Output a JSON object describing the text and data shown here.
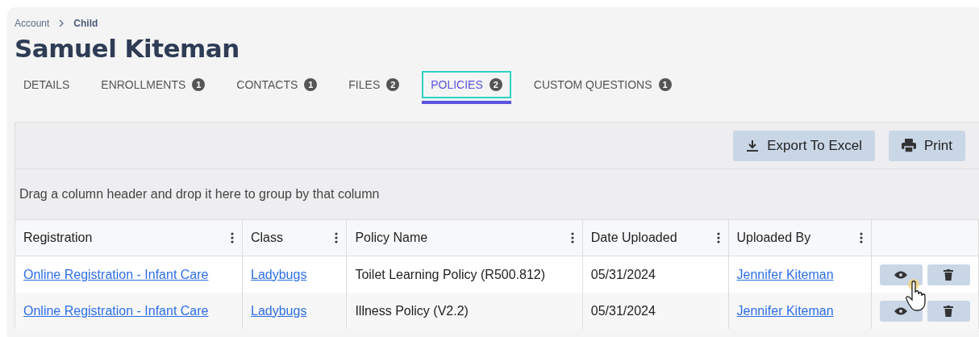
{
  "breadcrumb": [
    "Account",
    "Child"
  ],
  "title": "Samuel Kiteman",
  "tabs": [
    {
      "label": "DETAILS",
      "selected": false
    },
    {
      "label": "ENROLLMENTS",
      "count": "1",
      "selected": false
    },
    {
      "label": "CONTACTS",
      "count": "1",
      "selected": false
    },
    {
      "label": "FILES",
      "count": "2",
      "selected": false
    },
    {
      "label": "POLICIES",
      "count": "2",
      "selected": true
    },
    {
      "label": "CUSTOM QUESTIONS",
      "count": "1",
      "selected": false
    }
  ],
  "toolbar": {
    "buttons": [
      {
        "kind": "export",
        "label": "Export To Excel"
      },
      {
        "kind": "print",
        "label": "Print"
      }
    ]
  },
  "group_panel": "Drag a column header and drop it here to group by that column",
  "table": {
    "columns": [
      "Registration",
      "Class",
      "Policy Name",
      "Date Uploaded",
      "Uploaded By"
    ],
    "rows": [
      {
        "registration": "Online Registration - Infant Care",
        "class": "Ladybugs",
        "policy_name": "Toilet Learning Policy (R500.812)",
        "date_uploaded": "05/31/2024",
        "uploaded_by": "Jennifer Kiteman"
      },
      {
        "registration": "Online Registration - Infant Care",
        "class": "Ladybugs",
        "policy_name": "Illness Policy (V2.2)",
        "date_uploaded": "05/31/2024",
        "uploaded_by": "Jennifer Kiteman"
      }
    ]
  }
}
